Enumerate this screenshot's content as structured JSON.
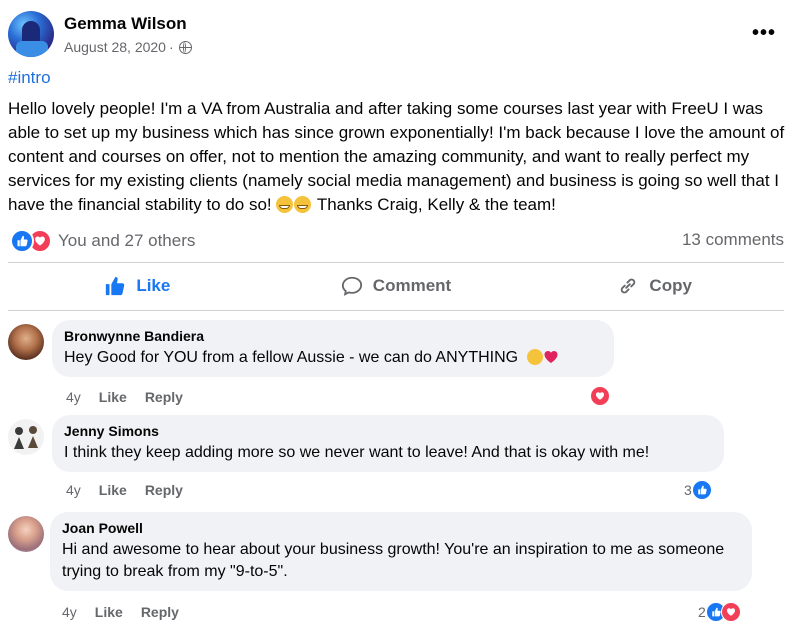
{
  "post": {
    "author": "Gemma Wilson",
    "date": "August 28, 2020",
    "date_separator": "·",
    "more_label": "•••",
    "hashtag": "#intro",
    "body": "Hello lovely people! I'm a VA from Australia and after taking some courses last year with FreeU I was able to set up my business which has since grown exponentially! I'm back because I love the amount of content and courses on offer, not to mention the amazing community, and want to really perfect my services for my existing clients (namely social media management) and business is going so well that I have the financial stability to do so!",
    "body_end": " Thanks Craig, Kelly & the team!",
    "reactions_text": "You and 27 others",
    "comments_count": "13 comments"
  },
  "actions": {
    "like": "Like",
    "comment": "Comment",
    "copy": "Copy"
  },
  "comments": [
    {
      "name": "Bronwynne Bandiera",
      "text": "Hey Good for YOU from a fellow Aussie - we can do ANYTHING",
      "age": "4y",
      "like": "Like",
      "reply": "Reply",
      "reaction_count": ""
    },
    {
      "name": "Jenny Simons",
      "text": "I think they keep adding more so we never want to leave! And that is okay with me!",
      "age": "4y",
      "like": "Like",
      "reply": "Reply",
      "reaction_count": "3"
    },
    {
      "name": "Joan Powell",
      "text": "Hi and awesome to hear about your business growth! You're an inspiration to me as someone trying to break from my \"9-to-5\".",
      "age": "4y",
      "like": "Like",
      "reply": "Reply",
      "reaction_count": "2"
    }
  ],
  "colors": {
    "accent": "#1877f2",
    "love": "#f33e58",
    "hashtag": "#216fdb",
    "secondary_text": "#65676b",
    "bubble": "#f0f2f5"
  },
  "icons": [
    "globe-icon",
    "more-options-icon",
    "like-reaction-icon",
    "love-reaction-icon",
    "thumbs-up-icon",
    "comment-bubble-icon",
    "copy-link-icon",
    "clap-emoji-icon",
    "heart-emoji-icon",
    "grin-emoji-icon"
  ]
}
